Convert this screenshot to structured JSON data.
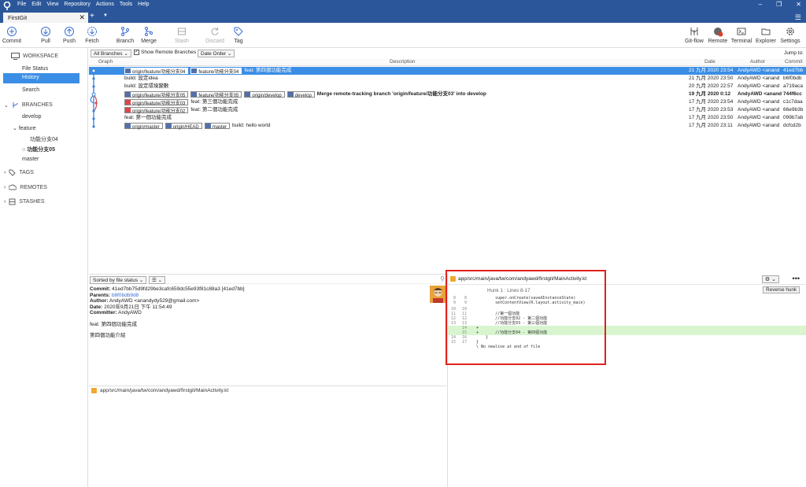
{
  "titlebar": {
    "menu": [
      "File",
      "Edit",
      "View",
      "Repository",
      "Actions",
      "Tools",
      "Help"
    ],
    "minimize": "–",
    "maximize": "❐",
    "close": "✕"
  },
  "tabs": [
    {
      "label": "FirstGit",
      "close": "✕"
    }
  ],
  "toolbar": {
    "left": [
      "Commit",
      "Pull",
      "Push",
      "Fetch",
      "Branch",
      "Merge",
      "Stash",
      "Discard",
      "Tag"
    ],
    "right": [
      "Git-flow",
      "Remote",
      "Terminal",
      "Explorer",
      "Settings"
    ],
    "remote_badge": "!"
  },
  "sidebar": {
    "workspace": "WORKSPACE",
    "file_status": "File Status",
    "history": "History",
    "search": "Search",
    "branches": "BRANCHES",
    "develop": "develop",
    "feature": "feature",
    "feature_branch_1": "功能分支04",
    "feature_branch_2": "功能分支05",
    "master": "master",
    "tags": "TAGS",
    "remotes": "REMOTES",
    "stashes": "STASHES"
  },
  "filter": {
    "branches_dropdown": "All Branches",
    "show_remote_branches": "Show Remote Branches",
    "order_dropdown": "Date Order",
    "jump_to": "Jump to:"
  },
  "columns": {
    "graph": "Graph",
    "description": "Description",
    "date": "Date",
    "author": "Author",
    "commit": "Commit"
  },
  "commits": [
    {
      "refs": [
        {
          "label": "origin/feature/功能分支04"
        },
        {
          "label": "feature/功能分支04"
        }
      ],
      "message": "feat: 第四個功能完成",
      "date": "21 九月 2020 23:54",
      "author": "AndyAWD <anand",
      "hash": "41ed7bb"
    },
    {
      "refs": [],
      "message": "build: 設定idea",
      "date": "21 九月 2020 23:50",
      "author": "AndyAWD <anand",
      "hash": "b6f0bdb"
    },
    {
      "refs": [],
      "message": "build: 設定環境變數",
      "date": "20 九月 2020 22:57",
      "author": "AndyAWD <anand",
      "hash": "a719aca"
    },
    {
      "refs": [
        {
          "label": "origin/feature/功能分支05"
        },
        {
          "label": "feature/功能分支05"
        },
        {
          "label": "origin/develop"
        },
        {
          "label": "develop"
        }
      ],
      "message": "Merge remote-tracking branch 'origin/feature/功能分支03' into develop",
      "date": "19 九月 2020 0:12",
      "author": "AndyAWD <anand",
      "hash": "744f6cc"
    },
    {
      "refs": [
        {
          "label": "origin/feature/功能分支03",
          "red": true
        }
      ],
      "message": "feat: 第三個功能完成",
      "date": "17 九月 2020 23:54",
      "author": "AndyAWD <anand",
      "hash": "c1c7daa"
    },
    {
      "refs": [
        {
          "label": "origin/feature/功能分支02",
          "red": true
        }
      ],
      "message": "feat: 第二個功能完成",
      "date": "17 九月 2020 23:53",
      "author": "AndyAWD <anand",
      "hash": "66e9b3b"
    },
    {
      "refs": [],
      "message": "feat: 第一個功能完成",
      "date": "17 九月 2020 23:50",
      "author": "AndyAWD <anand",
      "hash": "099b7ab"
    },
    {
      "refs": [
        {
          "label": "origin/master"
        },
        {
          "label": "origin/HEAD"
        },
        {
          "label": "master"
        }
      ],
      "message": "build: hello world",
      "date": "17 九月 2020 23:11",
      "author": "AndyAWD <anand",
      "hash": "dcfcd2b"
    }
  ],
  "lower": {
    "sort_dropdown": "Sorted by file status",
    "view_dropdown": "☰"
  },
  "commit_detail": {
    "commit_label": "Commit:",
    "commit_value": "41ed7bb75d9fd29be3cafc659dc55e93f81c88a3 [41ed7bb]",
    "parents_label": "Parents:",
    "parents_value": "b6f0bdb9d8",
    "author_label": "Author:",
    "author_value": "AndyAWD <anandydy529@gmail.com>",
    "date_label": "Date:",
    "date_value": "2020年9月21日 下午 11:54:49",
    "committer_label": "Committer:",
    "committer_value": "AndyAWD",
    "subject": "feat: 第四個功能完成",
    "body": "第四個功能介紹"
  },
  "file": {
    "path": "app/src/main/java/tw/com/andyawd/firstgit/MainActivity.kt"
  },
  "diff": {
    "path": "app/src/main/java/tw/com/andyawd/firstgit/MainActivity.kt",
    "hunk": "Hunk 1 : Lines 8-17",
    "reverse_hunk": "Reverse hunk",
    "lines": [
      {
        "n1": "8",
        "n2": "8",
        "code": "        super.onCreate(savedInstanceState)",
        "add": false
      },
      {
        "n1": "9",
        "n2": "9",
        "code": "        setContentView(R.layout.activity_main)",
        "add": false
      },
      {
        "n1": "10",
        "n2": "10",
        "code": "",
        "add": false
      },
      {
        "n1": "11",
        "n2": "11",
        "code": "        //第一個功能",
        "add": false
      },
      {
        "n1": "12",
        "n2": "12",
        "code": "        //功能分支02 - 第二個功能",
        "add": false
      },
      {
        "n1": "13",
        "n2": "13",
        "code": "        //功能分支03 - 第三個功能",
        "add": false
      },
      {
        "n1": "",
        "n2": "14",
        "code": "+",
        "add": true
      },
      {
        "n1": "",
        "n2": "15",
        "code": "+       //功能分支04 - 第四個功能",
        "add": true
      },
      {
        "n1": "14",
        "n2": "16",
        "code": "    }",
        "add": false
      },
      {
        "n1": "15",
        "n2": "17",
        "code": "}",
        "add": false
      },
      {
        "n1": "",
        "n2": "",
        "code": "\\ No newline at end of file",
        "add": false
      }
    ]
  }
}
